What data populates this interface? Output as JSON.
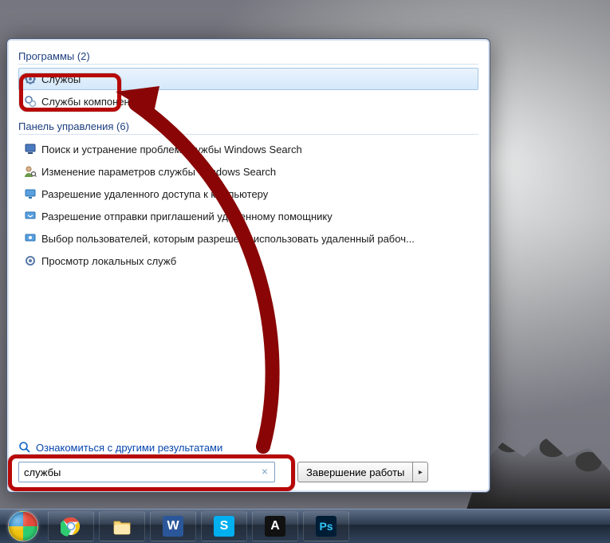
{
  "sections": {
    "programs": {
      "title": "Программы (2)",
      "items": [
        "Службы",
        "Службы компонентов"
      ]
    },
    "control_panel": {
      "title": "Панель управления (6)",
      "items": [
        "Поиск и устранение проблем службы Windows Search",
        "Изменение параметров службы Windows Search",
        "Разрешение удаленного доступа к компьютеру",
        "Разрешение отправки приглашений удаленному помощнику",
        "Выбор пользователей, которым разрешено использовать удаленный рабоч...",
        "Просмотр локальных служб"
      ]
    }
  },
  "more_results": "Ознакомиться с другими результатами",
  "search": {
    "value": "службы"
  },
  "shutdown": {
    "label": "Завершение работы"
  },
  "taskbar": {
    "items": [
      "chrome",
      "explorer",
      "word",
      "skype",
      "autocad",
      "photoshop"
    ]
  }
}
